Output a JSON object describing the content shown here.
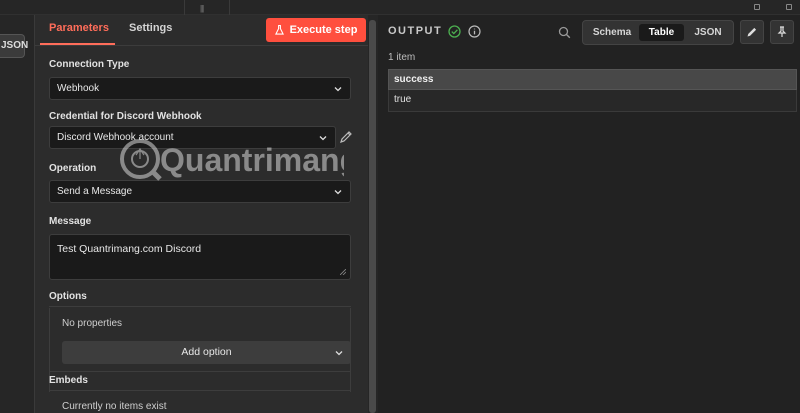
{
  "left": {
    "json_label": "JSON"
  },
  "tabs": [
    {
      "label": "Parameters"
    },
    {
      "label": "Settings"
    }
  ],
  "execute_label": "Execute step",
  "fields": {
    "connection_type": {
      "label": "Connection Type",
      "value": "Webhook"
    },
    "credential": {
      "label": "Credential for Discord Webhook",
      "value": "Discord Webhook account"
    },
    "operation": {
      "label": "Operation",
      "value": "Send a Message"
    },
    "message": {
      "label": "Message",
      "value": "Test Quantrimang.com Discord"
    }
  },
  "options": {
    "label": "Options",
    "empty": "No properties",
    "add_label": "Add option"
  },
  "embeds": {
    "label": "Embeds",
    "empty": "Currently no items exist"
  },
  "output": {
    "title": "OUTPUT",
    "views": [
      {
        "label": "Schema"
      },
      {
        "label": "Table"
      },
      {
        "label": "JSON"
      }
    ],
    "active_view": "Table",
    "items_count": "1 item",
    "table": {
      "header": "success",
      "rows": [
        "true"
      ]
    }
  },
  "watermark": {
    "text": "Quantrimang"
  },
  "colors": {
    "accent": "#ff6d5a",
    "execute_bg": "#ff4f3e",
    "success": "#4caf50"
  }
}
